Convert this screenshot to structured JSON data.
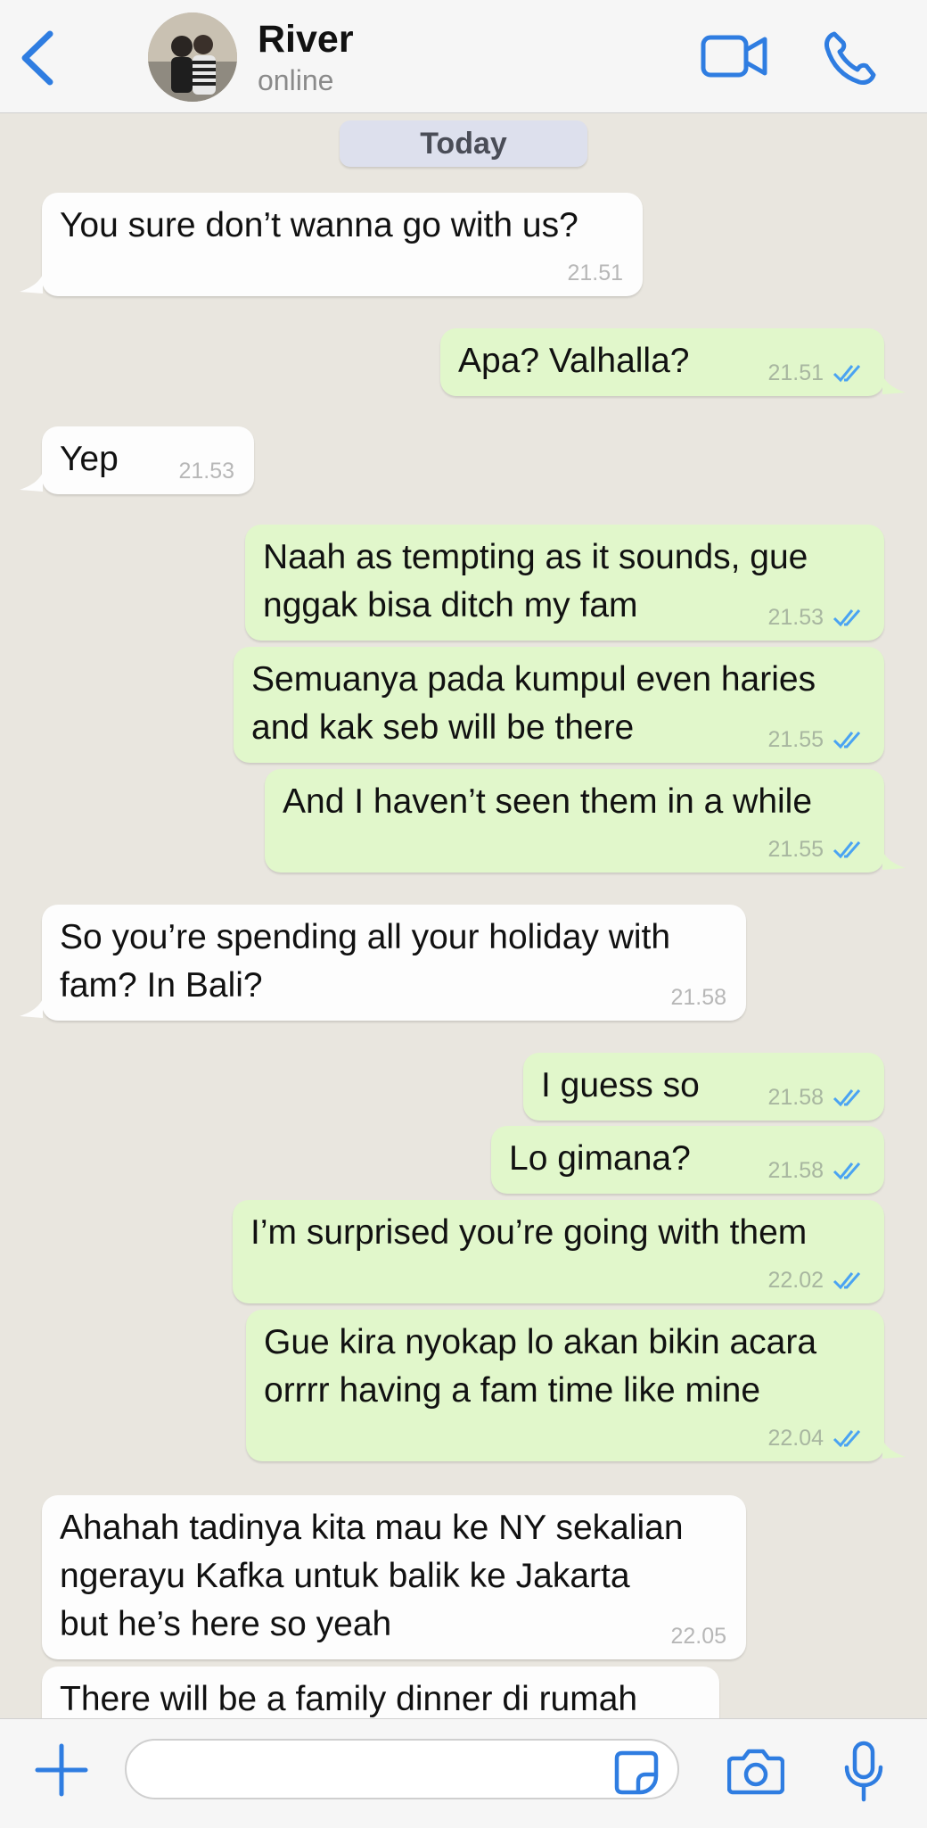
{
  "header": {
    "back_icon": "chevron-left-icon",
    "contact_name": "River",
    "status": "online",
    "video_icon": "video-camera-icon",
    "call_icon": "phone-icon",
    "accent": "#2f7de1"
  },
  "chat": {
    "date_label": "Today",
    "messages": [
      {
        "dir": "in",
        "text": "You sure don’t wanna go with us?",
        "time": "21.51"
      },
      {
        "dir": "out",
        "text": "Apa? Valhalla?",
        "time": "21.51"
      },
      {
        "dir": "in",
        "text": "Yep",
        "time": "21.53"
      },
      {
        "dir": "out",
        "text": "Naah as tempting as it sounds, gue\nnggak bisa ditch my fam",
        "time": "21.53"
      },
      {
        "dir": "out",
        "text": "Semuanya pada kumpul even haries\nand kak seb will be there",
        "time": "21.55"
      },
      {
        "dir": "out",
        "text": "And I haven’t seen them in a while",
        "time": "21.55"
      },
      {
        "dir": "in",
        "text": "So you’re spending all your holiday with\nfam? In Bali?",
        "time": "21.58"
      },
      {
        "dir": "out",
        "text": "I guess so",
        "time": "21.58"
      },
      {
        "dir": "out",
        "text": "Lo gimana?",
        "time": "21.58"
      },
      {
        "dir": "out",
        "text": "I’m surprised you’re going with them",
        "time": "22.02"
      },
      {
        "dir": "out",
        "text": "Gue kira nyokap lo akan bikin acara\norrrr having a fam time like mine",
        "time": "22.04"
      },
      {
        "dir": "in",
        "text": "Ahahah tadinya kita mau ke NY sekalian\nngerayu Kafka untuk balik ke Jakarta\nbut he’s here so yeah",
        "time": "22.05"
      },
      {
        "dir": "in",
        "text": "There will be a family dinner di rumah",
        "time": ""
      }
    ]
  },
  "composer": {
    "plus_icon": "plus-icon",
    "input_value": "",
    "sticker_icon": "sticker-icon",
    "camera_icon": "camera-icon",
    "mic_icon": "microphone-icon"
  }
}
